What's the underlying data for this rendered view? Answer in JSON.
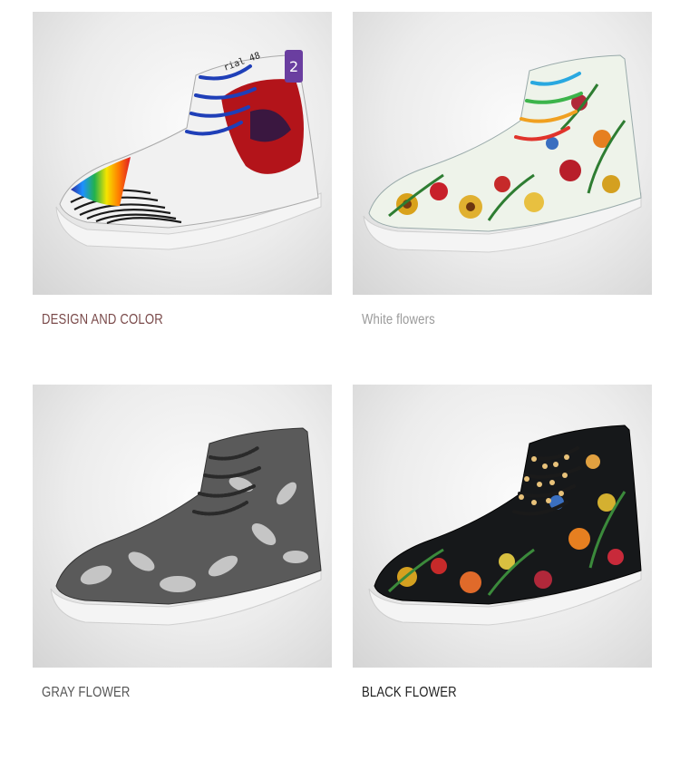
{
  "products": [
    {
      "caption": "DESIGN AND COLOR",
      "caption_color": "#7a4a4a"
    },
    {
      "caption": "White flowers",
      "caption_color": "#9a9a9a"
    },
    {
      "caption": "GRAY FLOWER",
      "caption_color": "#555555"
    },
    {
      "caption": "BLACK FLOWER",
      "caption_color": "#222222"
    }
  ],
  "shoe1": {
    "tongue_label": "2",
    "side_text": "rial 48"
  }
}
